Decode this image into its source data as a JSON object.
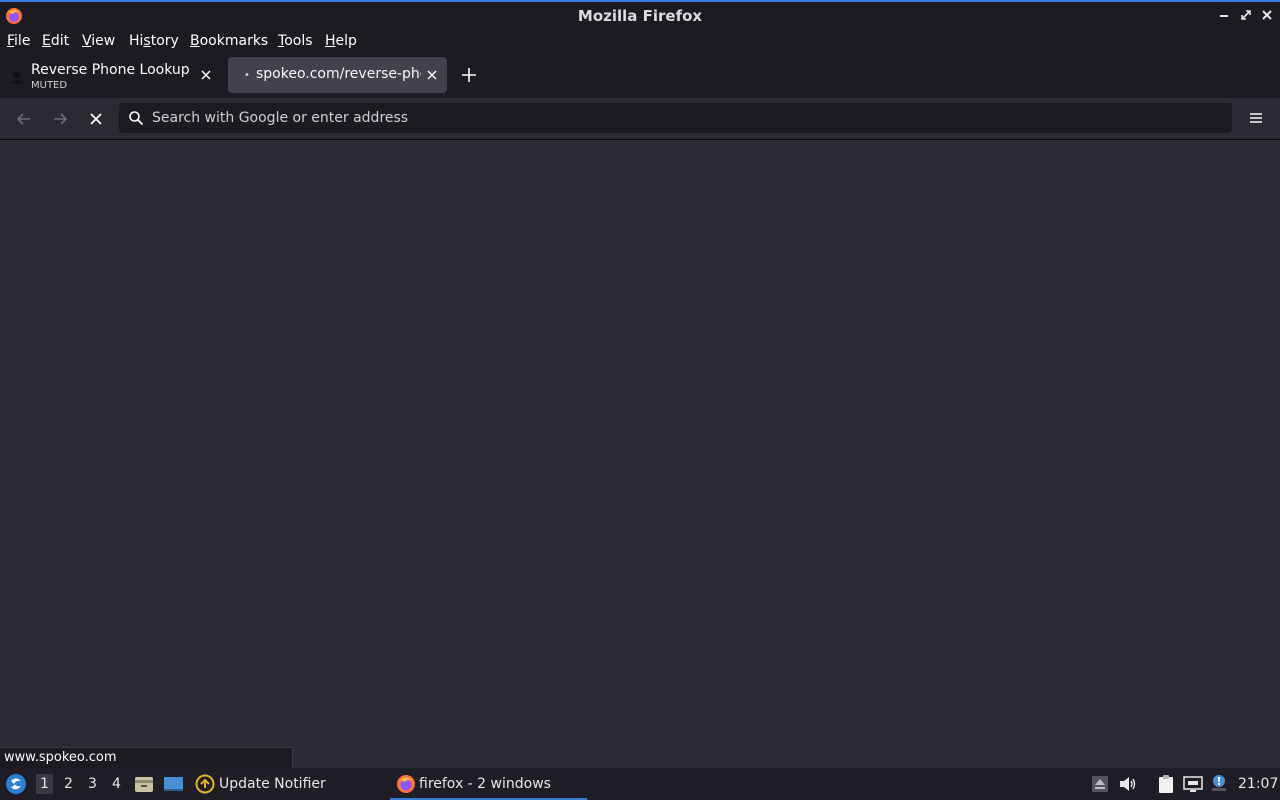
{
  "window": {
    "title": "Mozilla Firefox"
  },
  "menu": {
    "file": {
      "u": "F",
      "rest": "ile"
    },
    "edit": {
      "u": "E",
      "rest": "dit"
    },
    "view": {
      "u": "V",
      "rest": "iew"
    },
    "history": {
      "pre": "Hi",
      "u": "s",
      "rest": "tory"
    },
    "bookmarks": {
      "u": "B",
      "rest": "ookmarks"
    },
    "tools": {
      "u": "T",
      "rest": "ools"
    },
    "help": {
      "u": "H",
      "rest": "elp"
    }
  },
  "tabs": [
    {
      "title": "Reverse Phone Lookup | Find",
      "subtitle": "MUTED"
    },
    {
      "title": "spokeo.com/reverse-phone-lookup",
      "loading_dot": "•"
    }
  ],
  "urlbar": {
    "placeholder": "Search with Google or enter address",
    "value": ""
  },
  "status": {
    "url": "www.spokeo.com"
  },
  "taskbar": {
    "workspaces": [
      "1",
      "2",
      "3",
      "4"
    ],
    "active_workspace": "1",
    "update_notifier": "Update Notifier",
    "firefox_task": "firefox - 2 windows",
    "clock": "21:07"
  },
  "colors": {
    "accent": "#3d7bd9",
    "background": "#2b2a33",
    "chrome": "#1c1b22"
  },
  "icons": {
    "window": [
      "firefox-logo-icon",
      "minimize-icon",
      "maximize-icon",
      "close-icon"
    ],
    "nav": [
      "back-icon",
      "forward-icon",
      "stop-icon",
      "search-icon",
      "app-menu-icon"
    ],
    "taskbar": [
      "start-menu-icon",
      "file-manager-icon",
      "desktop-icon",
      "update-notifier-icon",
      "firefox-icon",
      "eject-icon",
      "volume-icon",
      "clipboard-icon",
      "network-icon",
      "notification-icon"
    ]
  }
}
